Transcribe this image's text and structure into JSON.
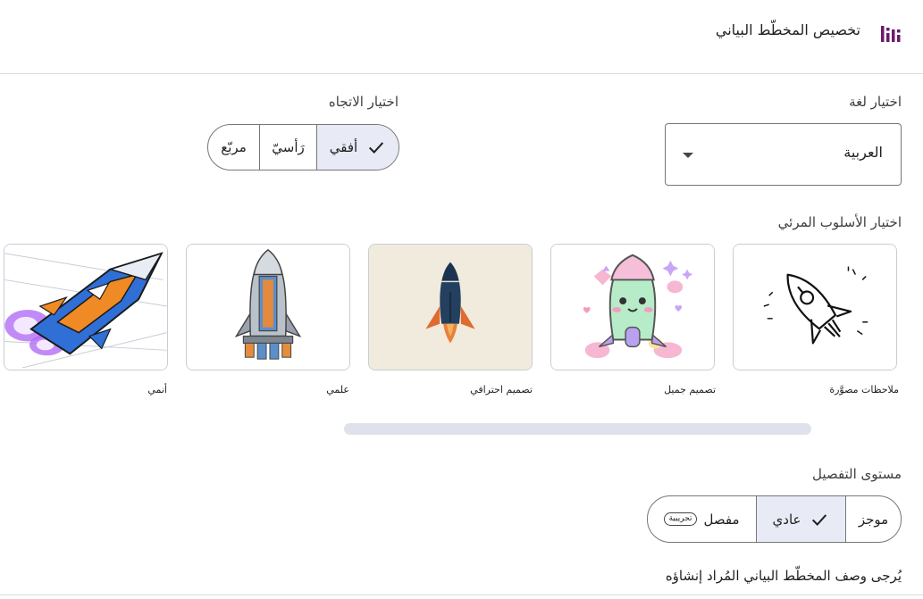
{
  "header": {
    "title": "تخصيص المخطّط البياني",
    "icon": "bar-chart-icon",
    "accent_color": "#6a1b6a"
  },
  "language": {
    "label": "اختيار لغة",
    "selected": "العربية"
  },
  "orientation": {
    "label": "اختيار الاتجاه",
    "options": [
      {
        "label": "أفقي",
        "selected": true
      },
      {
        "label": "رَأسيّ",
        "selected": false
      },
      {
        "label": "مربّع",
        "selected": false
      }
    ]
  },
  "visual_style": {
    "label": "اختيار الأسلوب المرئي",
    "items": [
      {
        "caption": "ملاحظات مصوَّرة",
        "icon": "sketch-rocket-icon"
      },
      {
        "caption": "تصميم جميل",
        "icon": "cute-rocket-icon"
      },
      {
        "caption": "تصميم احترافي",
        "icon": "flat-rocket-icon"
      },
      {
        "caption": "علمي",
        "icon": "technical-rocket-icon"
      },
      {
        "caption": "أنمي",
        "icon": "anime-spaceship-icon"
      }
    ]
  },
  "detail_level": {
    "label": "مستوى التفصيل",
    "options": [
      {
        "label": "موجز",
        "selected": false
      },
      {
        "label": "عادي",
        "selected": true
      },
      {
        "label": "مفصل",
        "selected": false,
        "badge": "تجريبية"
      }
    ]
  },
  "description": {
    "label": "يُرجى وصف المخطّط البياني المُراد إنشاؤه"
  }
}
